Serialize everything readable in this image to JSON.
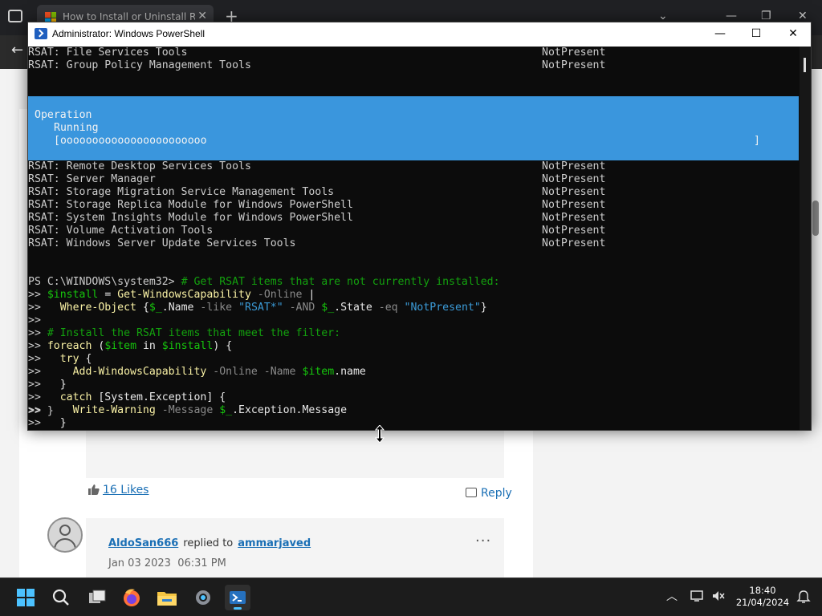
{
  "browser": {
    "tab_title": "How to Install or Uninstall RSAT",
    "tab_close": "✕",
    "new_tab": "+",
    "minimize": "—",
    "restore": "❐",
    "close": "✕",
    "back": "←"
  },
  "post": {
    "likes_label": "16 Likes",
    "reply_label": "Reply",
    "reply_author": "AldoSan666",
    "replied_to_text": "replied to",
    "replied_to_user": "ammarjaved",
    "date": "Jan 03 2023",
    "time": "06:31 PM",
    "more": "···"
  },
  "powershell": {
    "title": "Administrator: Windows PowerShell",
    "minimize": "—",
    "maximize": "☐",
    "close": "✕",
    "top_rows": [
      {
        "name": "RSAT: File Services Tools",
        "state": "NotPresent"
      },
      {
        "name": "RSAT: Group Policy Management Tools",
        "state": "NotPresent"
      }
    ],
    "progress": {
      "heading": "Operation",
      "status": "Running",
      "bar": "[ooooooooooooooooooooooo",
      "bar_end": "]"
    },
    "rows": [
      {
        "name": "RSAT: Remote Desktop Services Tools",
        "state": "NotPresent"
      },
      {
        "name": "RSAT: Server Manager",
        "state": "NotPresent"
      },
      {
        "name": "RSAT: Storage Migration Service Management Tools",
        "state": "NotPresent"
      },
      {
        "name": "RSAT: Storage Replica Module for Windows PowerShell",
        "state": "NotPresent"
      },
      {
        "name": "RSAT: System Insights Module for Windows PowerShell",
        "state": "NotPresent"
      },
      {
        "name": "RSAT: Volume Activation Tools",
        "state": "NotPresent"
      },
      {
        "name": "RSAT: Windows Server Update Services Tools",
        "state": "NotPresent"
      }
    ],
    "prompt": "PS C:\\WINDOWS\\system32>",
    "script": {
      "c1": "# Get RSAT items that are not currently installed:",
      "l2_var": "$install",
      "l2_eq": " = ",
      "l2_cmd": "Get-WindowsCapability",
      "l2_par": " -Online ",
      "l2_pipe": "|",
      "l3_cmd": "Where-Object",
      "l3_open": " {",
      "l3_var": "$_",
      "l3_prop": ".Name",
      "l3_like": " -like ",
      "l3_str1": "\"RSAT*\"",
      "l3_and": " -AND ",
      "l3_var2": "$_",
      "l3_prop2": ".State",
      "l3_eqop": " -eq ",
      "l3_str2": "\"NotPresent\"",
      "l3_close": "}",
      "c2": "# Install the RSAT items that meet the filter:",
      "l6_kw": "foreach",
      "l6_open": " (",
      "l6_var": "$item",
      "l6_in": " in ",
      "l6_var2": "$install",
      "l6_close": ") {",
      "l7_kw": "try",
      "l7_brace": " {",
      "l8_cmd": "Add-WindowsCapability",
      "l8_p1": " -Online",
      "l8_p2": " -Name ",
      "l8_var": "$item",
      "l8_prop": ".name",
      "l9": "}",
      "l10_kw": "catch",
      "l10_rest": " [System.Exception] {",
      "l11_cmd": "Write-Warning",
      "l11_par": " -Message ",
      "l11_var": "$_",
      "l11_prop": ".Exception.Message",
      "l12": "}",
      "l13": "}"
    },
    "continuation": ">>"
  },
  "taskbar": {
    "time": "18:40",
    "date": "21/04/2024",
    "chevron": "︿"
  }
}
